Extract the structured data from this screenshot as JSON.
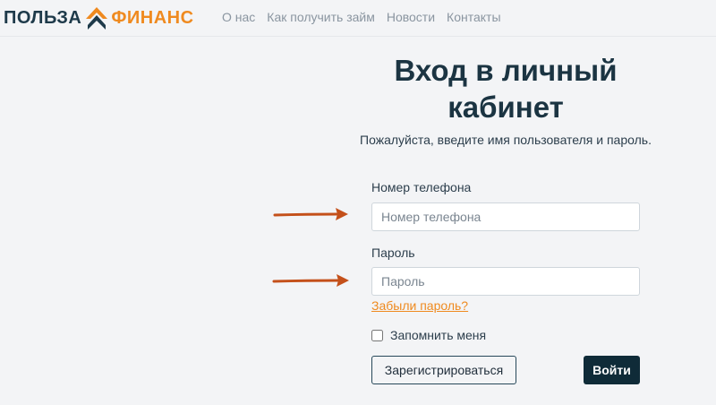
{
  "brand": {
    "name_left": "ПОЛЬЗА",
    "name_right": "ФИНАНС",
    "logo_icon": "double-chevron-up-logo",
    "colors": {
      "dark": "#1e3a4a",
      "accent": "#ef8a1f"
    }
  },
  "nav": {
    "items": [
      {
        "label": "О нас"
      },
      {
        "label": "Как получить займ"
      },
      {
        "label": "Новости"
      },
      {
        "label": "Контакты"
      }
    ]
  },
  "login": {
    "title": "Вход в личный кабинет",
    "subtitle": "Пожалуйста, введите имя пользователя и пароль.",
    "phone_label": "Номер телефона",
    "phone_placeholder": "Номер телефона",
    "phone_value": "",
    "password_label": "Пароль",
    "password_placeholder": "Пароль",
    "password_value": "",
    "forgot_link": "Забыли пароль?",
    "remember_label": "Запомнить меня",
    "remember_checked": false,
    "register_button": "Зарегистрироваться",
    "login_button": "Войти"
  },
  "annotations": {
    "arrow_color": "#c4501a",
    "arrow_icon": "right-arrow-icon"
  }
}
